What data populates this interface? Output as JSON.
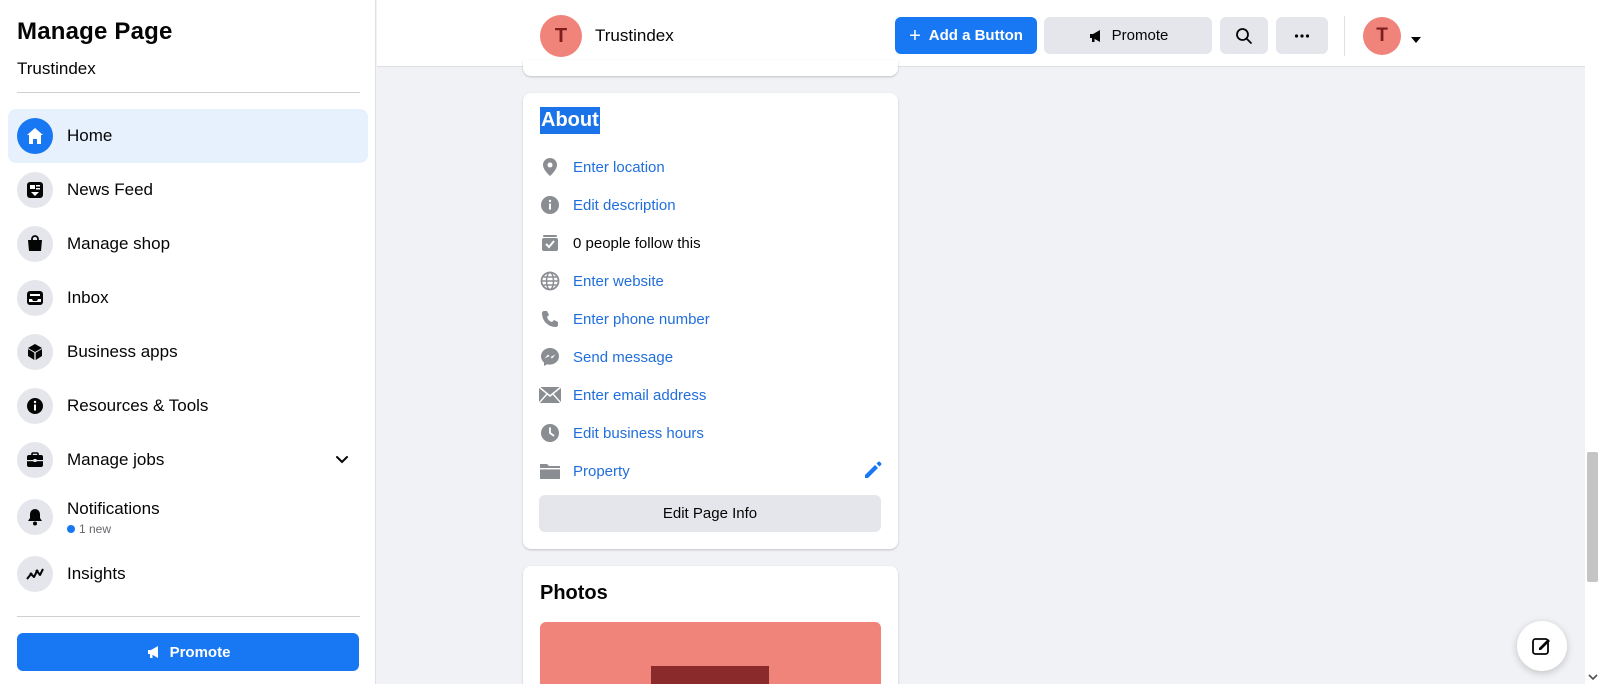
{
  "sidebar": {
    "title": "Manage Page",
    "page_name": "Trustindex",
    "items": [
      {
        "label": "Home",
        "icon": "home-icon",
        "active": true
      },
      {
        "label": "News Feed",
        "icon": "news-feed-icon"
      },
      {
        "label": "Manage shop",
        "icon": "shopping-bag-icon"
      },
      {
        "label": "Inbox",
        "icon": "inbox-icon"
      },
      {
        "label": "Business apps",
        "icon": "cube-icon"
      },
      {
        "label": "Resources & Tools",
        "icon": "info-icon"
      },
      {
        "label": "Manage jobs",
        "icon": "briefcase-icon"
      },
      {
        "label": "Notifications",
        "icon": "bell-icon",
        "badge": "1 new"
      },
      {
        "label": "Insights",
        "icon": "insights-icon"
      }
    ],
    "promote_label": "Promote"
  },
  "topbar": {
    "avatar_letter": "T",
    "page_name": "Trustindex",
    "add_button_label": "Add a Button",
    "promote_label": "Promote",
    "user_avatar_letter": "T"
  },
  "about": {
    "title": "About",
    "rows": [
      {
        "text": "Enter location",
        "icon": "location-pin-icon",
        "link": true
      },
      {
        "text": "Edit description",
        "icon": "info-circle-icon",
        "link": true
      },
      {
        "text": "0 people follow this",
        "icon": "follow-check-icon",
        "link": false
      },
      {
        "text": "Enter website",
        "icon": "globe-icon",
        "link": true
      },
      {
        "text": "Enter phone number",
        "icon": "phone-icon",
        "link": true
      },
      {
        "text": "Send message",
        "icon": "messenger-icon",
        "link": true
      },
      {
        "text": "Enter email address",
        "icon": "envelope-icon",
        "link": true
      },
      {
        "text": "Edit business hours",
        "icon": "clock-icon",
        "link": true
      },
      {
        "text": "Property",
        "icon": "category-folder-icon",
        "link": true
      }
    ],
    "edit_button_label": "Edit Page Info"
  },
  "photos": {
    "title": "Photos"
  },
  "colors": {
    "accent": "#1877f2",
    "link": "#216fdb",
    "avatar_bg": "#f0837a"
  }
}
